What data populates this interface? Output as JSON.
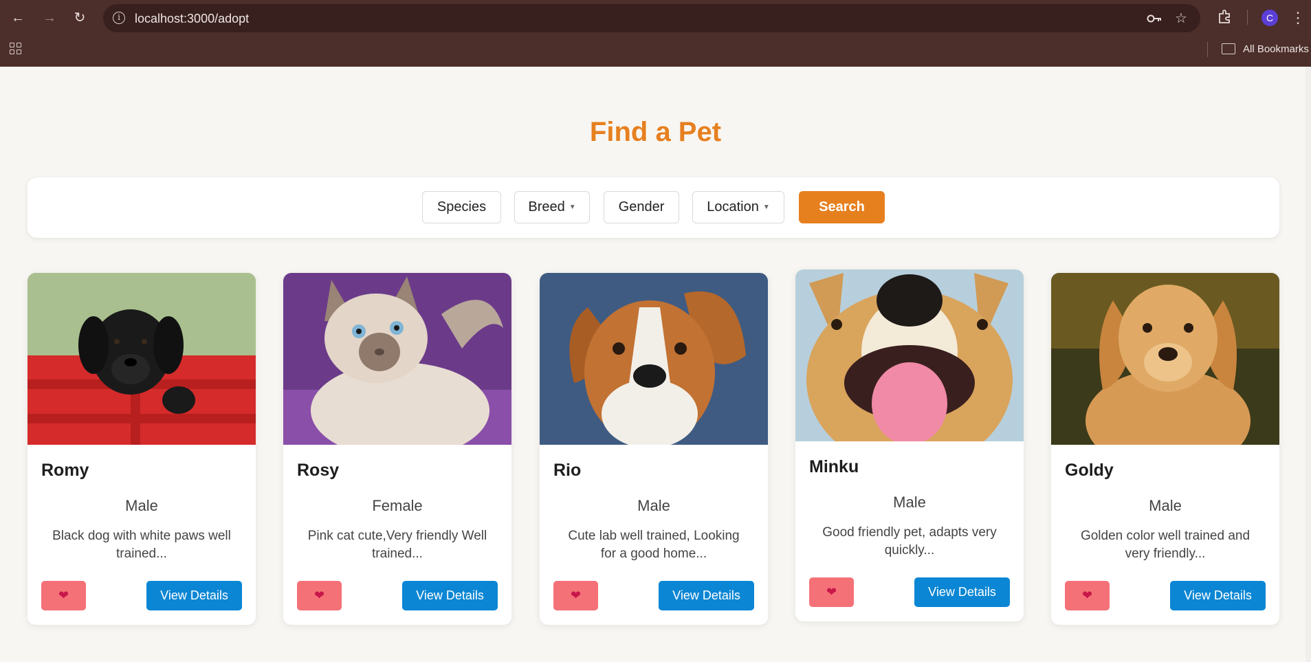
{
  "browser": {
    "url": "localhost:3000/adopt",
    "bookmarks_label": "All Bookmarks",
    "profile_initial": "C"
  },
  "page": {
    "title": "Find a Pet",
    "accent": "#e6801f"
  },
  "filters": {
    "species_label": "Species",
    "breed_label": "Breed",
    "gender_label": "Gender",
    "location_label": "Location",
    "search_label": "Search"
  },
  "pets": [
    {
      "name": "Romy",
      "gender": "Male",
      "description": "Black dog with white paws well trained...",
      "view_label": "View Details"
    },
    {
      "name": "Rosy",
      "gender": "Female",
      "description": "Pink cat cute,Very friendly Well trained...",
      "view_label": "View Details"
    },
    {
      "name": "Rio",
      "gender": "Male",
      "description": "Cute lab well trained, Looking for a good home...",
      "view_label": "View Details"
    },
    {
      "name": "Minku",
      "gender": "Male",
      "description": "Good friendly pet, adapts very quickly...",
      "view_label": "View Details"
    },
    {
      "name": "Goldy",
      "gender": "Male",
      "description": "Golden color well trained and very friendly...",
      "view_label": "View Details"
    }
  ]
}
